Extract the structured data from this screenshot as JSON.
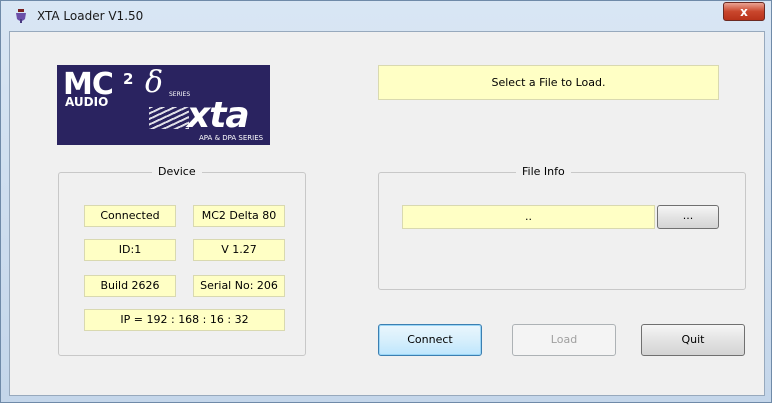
{
  "window": {
    "title": "XTA Loader V1.50",
    "close_glyph": "x"
  },
  "logo": {
    "line1": "MC",
    "sup": "2",
    "audio": "AUDIO",
    "delta": "δ",
    "series": "SERIES",
    "brand": "xta",
    "tagline": "APA & DPA SERIES"
  },
  "status": {
    "message": "Select a File to Load."
  },
  "device": {
    "title": "Device",
    "state": "Connected",
    "model": "MC2 Delta 80",
    "id": "ID:1",
    "version": "V 1.27",
    "build": "Build 2626",
    "serial": "Serial No: 206",
    "ip": "IP = 192 : 168 : 16 : 32"
  },
  "file_info": {
    "title": "File Info",
    "path": "..",
    "browse_label": "..."
  },
  "buttons": {
    "connect": "Connect",
    "load": "Load",
    "quit": "Quit"
  },
  "colors": {
    "field_bg": "#ffffc5",
    "logo_bg": "#2a2360",
    "close_red": "#c9462c"
  }
}
